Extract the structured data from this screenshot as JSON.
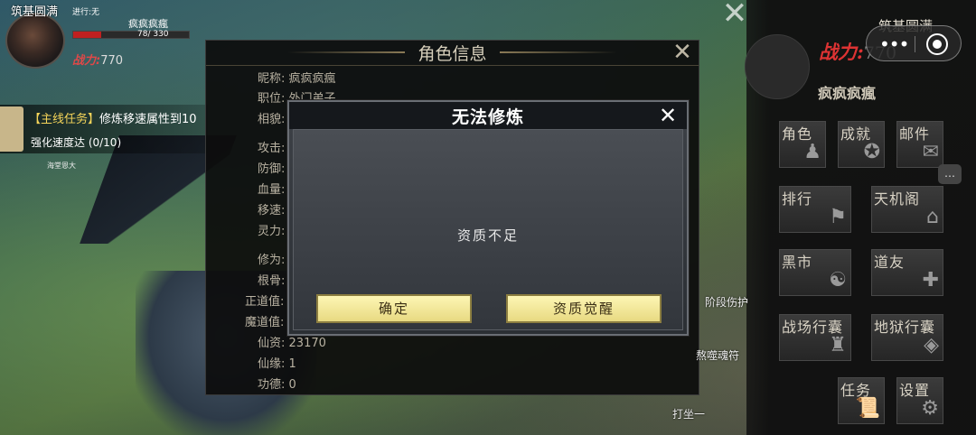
{
  "hud": {
    "realm": "筑基圆满",
    "progress": "进行:无",
    "player_name": "疯疯疯瘋",
    "hp_text": "78/ 330",
    "hp_fraction": 0.24,
    "power_label": "战力:",
    "power_value": "770"
  },
  "quest": {
    "title_tag": "【主线任务】",
    "title_body": "修炼移速属性到10",
    "subtitle": "强化速度达 (0/10)",
    "enemy_label": "海堂恩大"
  },
  "info_panel": {
    "title": "角色信息",
    "rows": [
      {
        "label": "昵称:",
        "value": "疯疯疯瘋"
      },
      {
        "label": "职位:",
        "value": "外门弟子"
      },
      {
        "label": "相貌:",
        "value": ""
      },
      {
        "label": "攻击:",
        "value": ""
      },
      {
        "label": "防御:",
        "value": ""
      },
      {
        "label": "血量:",
        "value": ""
      },
      {
        "label": "移速:",
        "value": ""
      },
      {
        "label": "灵力:",
        "value": ""
      },
      {
        "label": "修为:",
        "value": ""
      },
      {
        "label": "根骨:",
        "value": ""
      },
      {
        "label": "正道值:",
        "value": ""
      },
      {
        "label": "魔道值:",
        "value": ""
      },
      {
        "label": "仙资:",
        "value": "23170"
      },
      {
        "label": "仙缘:",
        "value": "1"
      },
      {
        "label": "功德:",
        "value": "0"
      }
    ]
  },
  "dialog": {
    "title": "无法修炼",
    "message": "资质不足",
    "confirm_label": "确定",
    "awaken_label": "资质觉醒"
  },
  "right_menu": {
    "realm": "筑基圆满",
    "power_label": "战力:",
    "power_value": "770",
    "player_name": "疯疯疯瘋",
    "items": [
      {
        "label": "角色",
        "icon": "character-icon"
      },
      {
        "label": "成就",
        "icon": "medal-icon"
      },
      {
        "label": "邮件",
        "icon": "mail-icon"
      },
      {
        "label": "排行",
        "icon": "ranking-icon"
      },
      {
        "label": "天机阁",
        "icon": "pavilion-icon"
      },
      {
        "label": "黑市",
        "icon": "black-market-icon"
      },
      {
        "label": "道友",
        "icon": "friends-icon"
      },
      {
        "label": "战场行囊",
        "icon": "battle-bag-icon"
      },
      {
        "label": "地狱行囊",
        "icon": "hell-bag-icon"
      },
      {
        "label": "任务",
        "icon": "task-scroll-icon"
      },
      {
        "label": "设置",
        "icon": "gear-icon"
      }
    ]
  },
  "world_labels": {
    "stage_hurt": "阶段伤护",
    "soul_talisman": "熬噬魂符",
    "meditate": "打坐一"
  },
  "colors": {
    "accent_gold": "#f5d55a",
    "power_red": "#d33333",
    "button_yellow": "#fdf6b4"
  }
}
